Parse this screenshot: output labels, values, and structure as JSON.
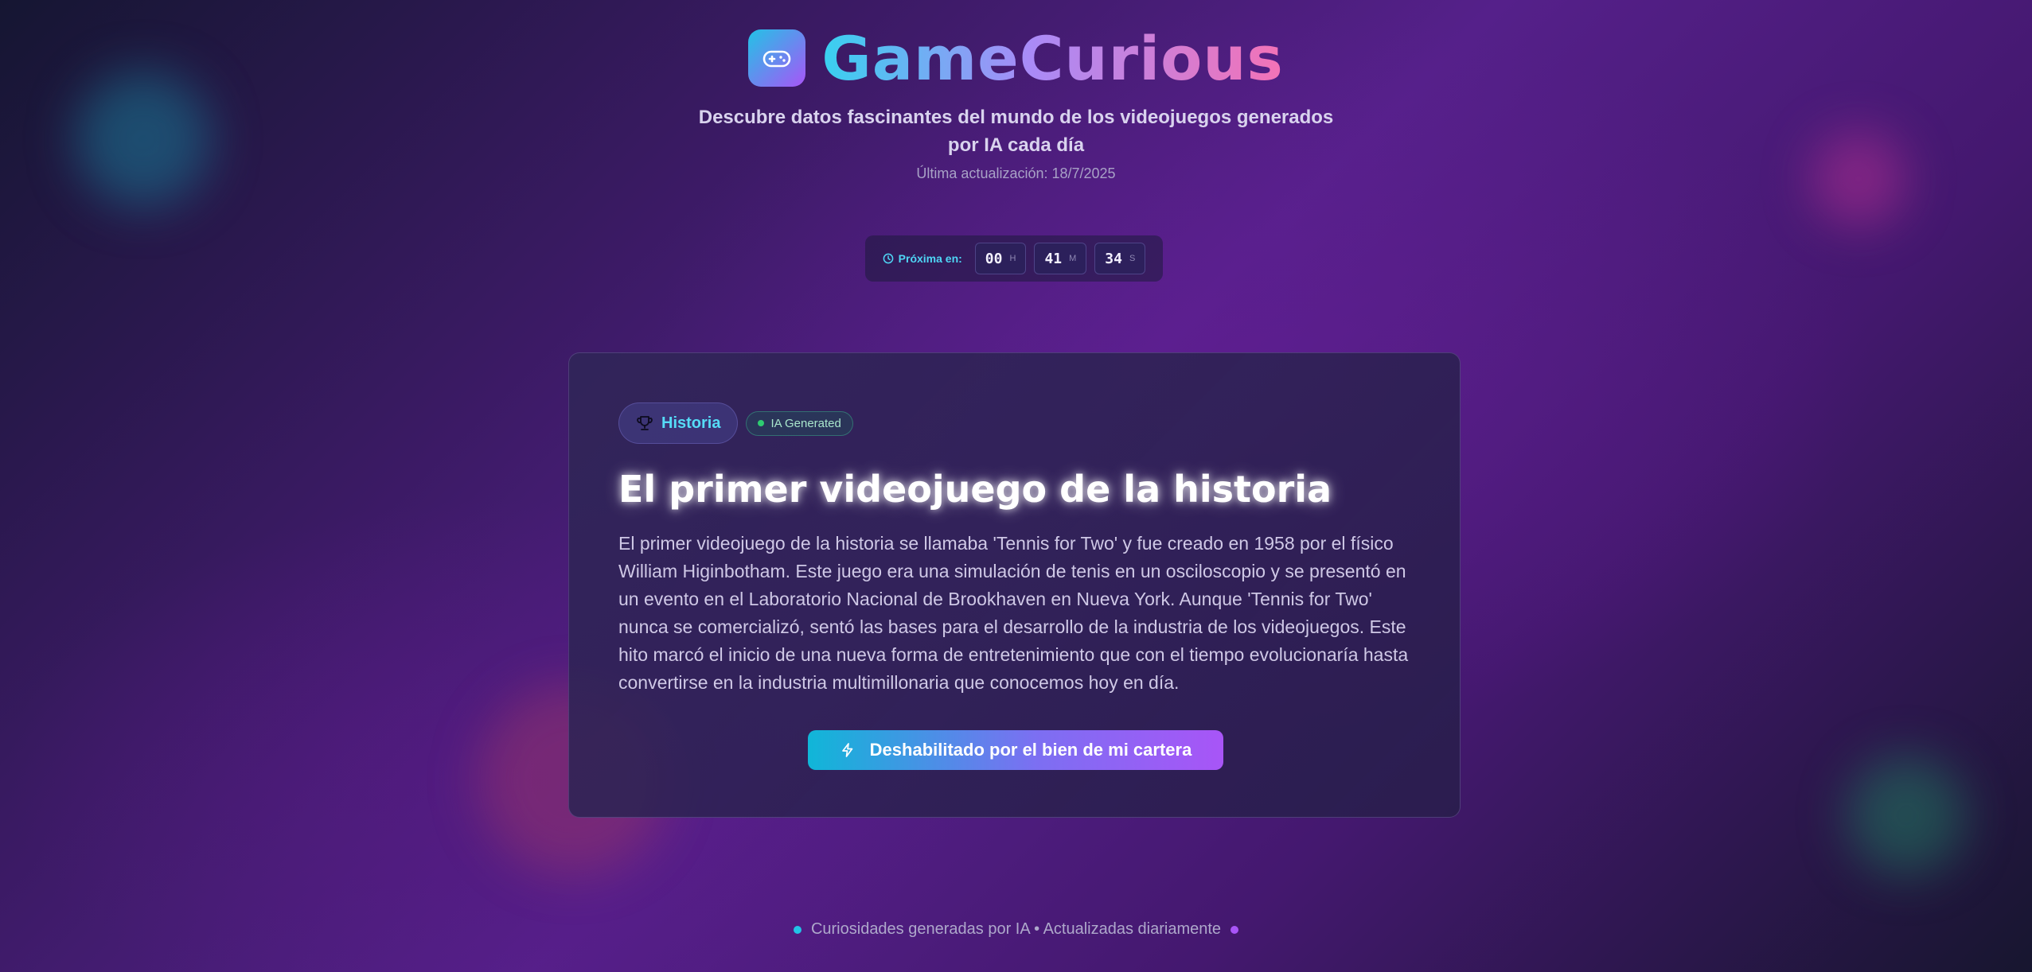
{
  "header": {
    "brand_name": "GameCurious",
    "logo_icon": "gamepad-icon",
    "tagline": "Descubre datos fascinantes del mundo de los videojuegos generados por IA cada día",
    "last_updated": "Última actualización: 18/7/2025"
  },
  "countdown": {
    "label": "Próxima en:",
    "icon": "clock-icon",
    "hours": "00",
    "hours_unit": "H",
    "minutes": "41",
    "minutes_unit": "M",
    "seconds": "34",
    "seconds_unit": "S"
  },
  "fact": {
    "category": "Historia",
    "category_icon": "trophy-icon",
    "ai_badge": "IA Generated",
    "title": "El primer videojuego de la historia",
    "body": "El primer videojuego de la historia se llamaba 'Tennis for Two' y fue creado en 1958 por el físico William Higinbotham. Este juego era una simulación de tenis en un osciloscopio y se presentó en un evento en el Laboratorio Nacional de Brookhaven en Nueva York. Aunque 'Tennis for Two' nunca se comercializó, sentó las bases para el desarrollo de la industria de los videojuegos. Este hito marcó el inicio de una nueva forma de entretenimiento que con el tiempo evolucionaría hasta convertirse en la industria multimillonaria que conocemos hoy en día.",
    "button_label": "Deshabilitado por el bien de mi cartera",
    "button_icon": "lightning-icon"
  },
  "footer": {
    "text": "Curiosidades generadas por IA • Actualizadas diariamente"
  },
  "colors": {
    "accent_cyan": "#22c3e6",
    "accent_purple": "#a855f7",
    "accent_pink": "#f472b6",
    "status_green": "#2ecc71"
  }
}
